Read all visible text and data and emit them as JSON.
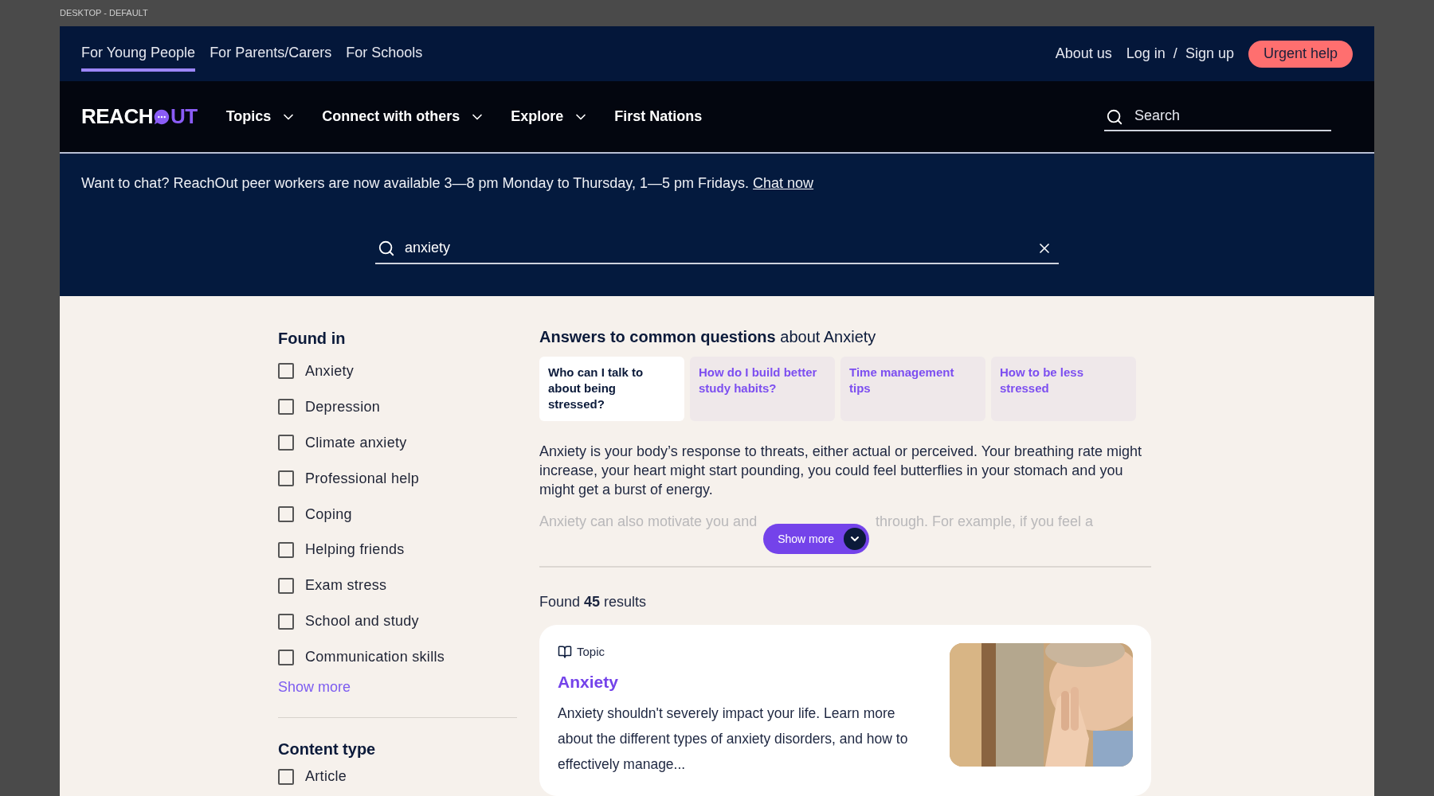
{
  "frame_label": "DESKTOP - DEFAULT",
  "audience_tabs": [
    {
      "label": "For Young People",
      "selected": true
    },
    {
      "label": "For Parents/Carers",
      "selected": false
    },
    {
      "label": "For Schools",
      "selected": false
    }
  ],
  "top_links": {
    "about": "About us",
    "login": "Log in",
    "separator": "/",
    "signup": "Sign up",
    "urgent": "Urgent help"
  },
  "logo": {
    "left": "REACH",
    "right": "UT"
  },
  "nav": [
    {
      "label": "Topics",
      "kind": "dropdown"
    },
    {
      "label": "Connect with others",
      "kind": "dropdown"
    },
    {
      "label": "Explore",
      "kind": "dropdown"
    },
    {
      "label": "First Nations",
      "kind": "link"
    }
  ],
  "nav_search": {
    "placeholder": "Search"
  },
  "banner": {
    "text": "Want to chat? ReachOut peer workers are now available 3—8 pm Monday to Thursday, 1—5 pm Fridays.",
    "link": "Chat now"
  },
  "search": {
    "value": "anxiety"
  },
  "filters": {
    "title": "Found in",
    "items": [
      {
        "label": "Anxiety",
        "checked": false
      },
      {
        "label": "Depression",
        "checked": false
      },
      {
        "label": "Climate anxiety",
        "checked": false
      },
      {
        "label": "Professional help",
        "checked": false
      },
      {
        "label": "Coping",
        "checked": false
      },
      {
        "label": "Helping friends",
        "checked": false
      },
      {
        "label": "Exam stress",
        "checked": false
      },
      {
        "label": "School and study",
        "checked": false
      },
      {
        "label": "Communication skills",
        "checked": false
      }
    ],
    "show_more": "Show more",
    "content_type_title": "Content type",
    "content_type_items": [
      {
        "label": "Article",
        "checked": false
      }
    ]
  },
  "answers": {
    "title": "**Answers to common questions** about Anxiety",
    "tabs": [
      {
        "label": "Who can I talk to about being stressed?",
        "selected": true
      },
      {
        "label": "How do I build better study habits?",
        "selected": false
      },
      {
        "label": "Time management tips",
        "selected": false
      },
      {
        "label": "How to be less stressed",
        "selected": false
      }
    ],
    "paragraph": "Anxiety is your body’s response to threats, either actual or perceived. Your breathing rate might increase, your heart might start pounding, you could feel butterflies in your stomach and you might get a burst of energy.",
    "faded_paragraph": [
      "Anxiety can also motivate you and",
      "through. For example, if you feel a"
    ],
    "show_more": "Show more"
  },
  "results_count": "Found **45** results",
  "results": [
    {
      "type": "Topic",
      "title": "Anxiety",
      "description": "Anxiety shouldn't severely impact your life. Learn more about the different types of anxiety disorders, and how to effectively manage..."
    }
  ]
}
